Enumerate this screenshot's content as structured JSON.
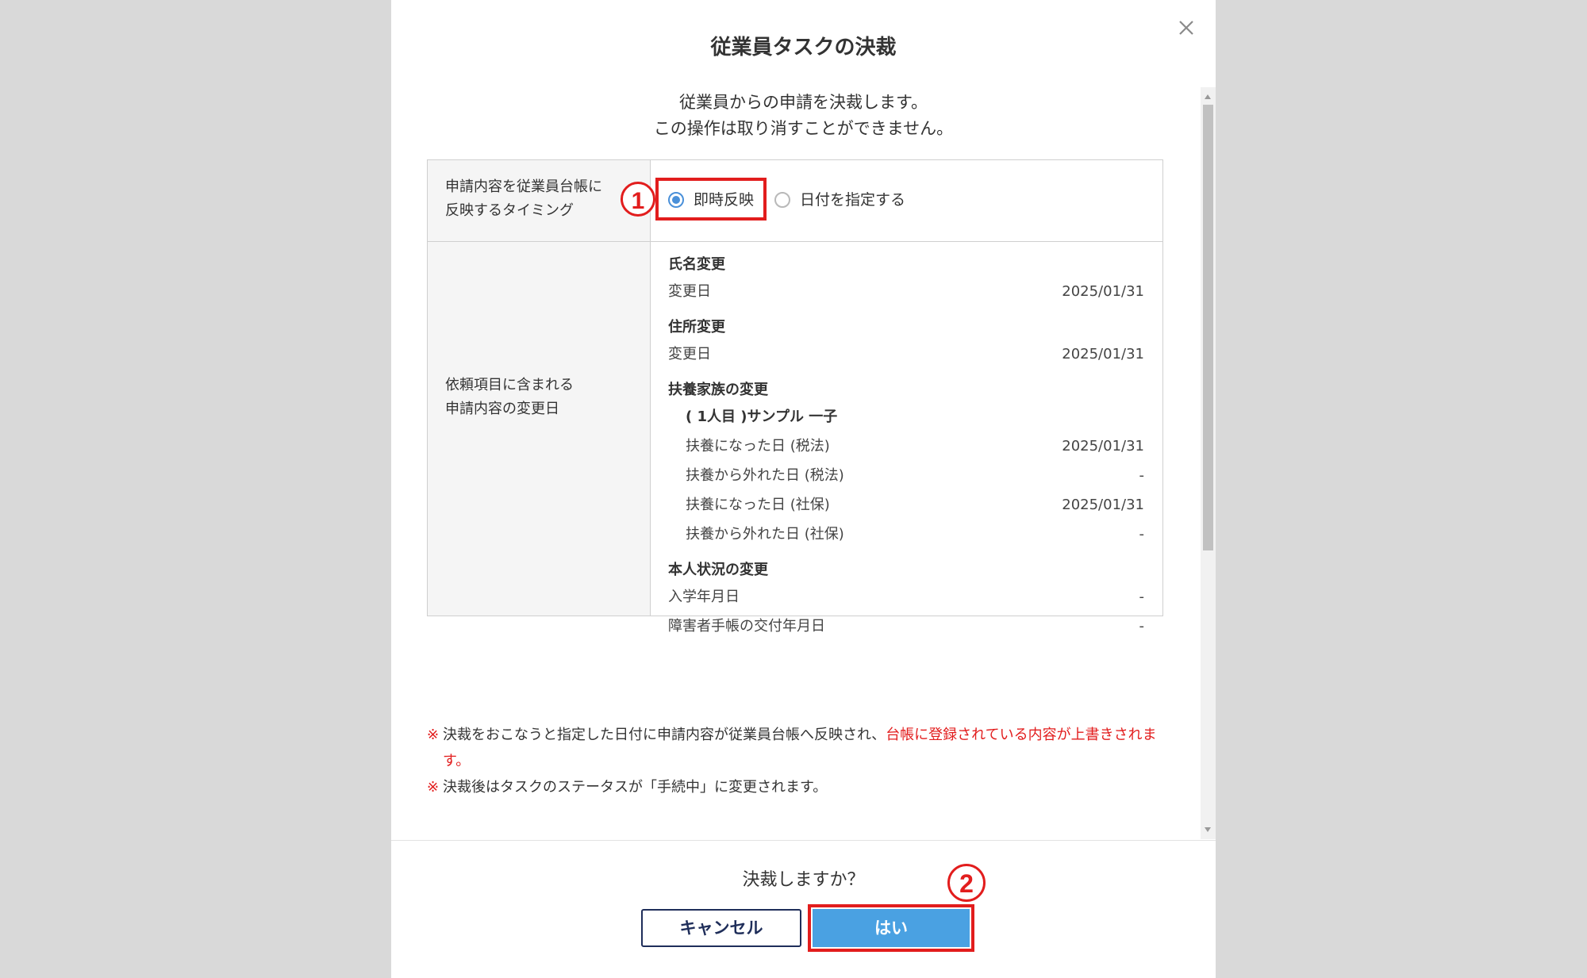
{
  "dialog": {
    "title": "従業員タスクの決裁",
    "intro_line1": "従業員からの申請を決裁します。",
    "intro_line2": "この操作は取り消すことができません。"
  },
  "table": {
    "timing_label_1": "申請内容を従業員台帳に",
    "timing_label_2": "反映するタイミング",
    "radio_options": [
      {
        "label": "即時反映",
        "selected": true
      },
      {
        "label": "日付を指定する",
        "selected": false
      }
    ],
    "changes_label_1": "依頼項目に含まれる",
    "changes_label_2": "申請内容の変更日",
    "groups": [
      {
        "title": "氏名変更",
        "rows": [
          {
            "label": "変更日",
            "value": "2025/01/31"
          }
        ]
      },
      {
        "title": "住所変更",
        "rows": [
          {
            "label": "変更日",
            "value": "2025/01/31"
          }
        ]
      },
      {
        "title": "扶養家族の変更",
        "subtitle": "( 1人目 )サンプル 一子",
        "rows": [
          {
            "label": "扶養になった日 (税法)",
            "value": "2025/01/31"
          },
          {
            "label": "扶養から外れた日 (税法)",
            "value": "-"
          },
          {
            "label": "扶養になった日 (社保)",
            "value": "2025/01/31"
          },
          {
            "label": "扶養から外れた日 (社保)",
            "value": "-"
          }
        ]
      },
      {
        "title": "本人状況の変更",
        "rows": [
          {
            "label": "入学年月日",
            "value": "-"
          },
          {
            "label": "障害者手帳の交付年月日",
            "value": "-"
          }
        ]
      }
    ]
  },
  "notes": {
    "mark": "※",
    "note1_plain": "決裁をおこなうと指定した日付に申請内容が従業員台帳へ反映され、",
    "note1_red": "台帳に登録されている内容が上書きされます。",
    "note2": "決裁後はタスクのステータスが「手続中」に変更されます。"
  },
  "footer": {
    "confirm_text": "決裁しますか？",
    "cancel_label": "キャンセル",
    "yes_label": "はい"
  },
  "annotations": {
    "marker1": "1",
    "marker2": "2"
  },
  "icons": {
    "close": "close-icon"
  },
  "colors": {
    "highlight": "#e21d1d",
    "primary_button": "#4aa1e2",
    "cancel_border": "#1f2e5a",
    "radio_selected": "#4a90d9"
  }
}
